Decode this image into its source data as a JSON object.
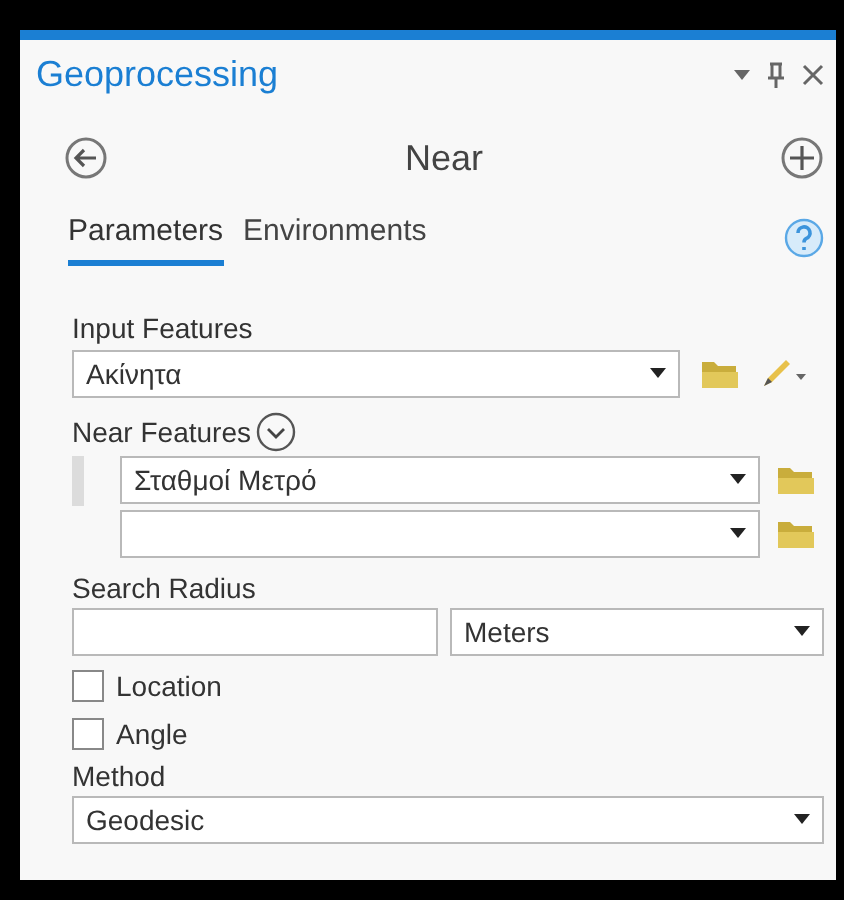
{
  "pane": {
    "title": "Geoprocessing"
  },
  "tool": {
    "name": "Near"
  },
  "tabs": [
    {
      "label": "Parameters",
      "selected": true
    },
    {
      "label": "Environments",
      "selected": false
    }
  ],
  "input_features": {
    "label": "Input Features",
    "value": "Ακίνητα"
  },
  "near_features": {
    "label": "Near Features",
    "rows": [
      {
        "value": "Σταθμοί Μετρό"
      },
      {
        "value": ""
      }
    ]
  },
  "search_radius": {
    "label": "Search Radius",
    "unit": "Meters"
  },
  "options": [
    {
      "label": "Location",
      "checked": false
    },
    {
      "label": "Angle",
      "checked": false
    }
  ],
  "method": {
    "label": "Method",
    "value": "Geodesic"
  }
}
